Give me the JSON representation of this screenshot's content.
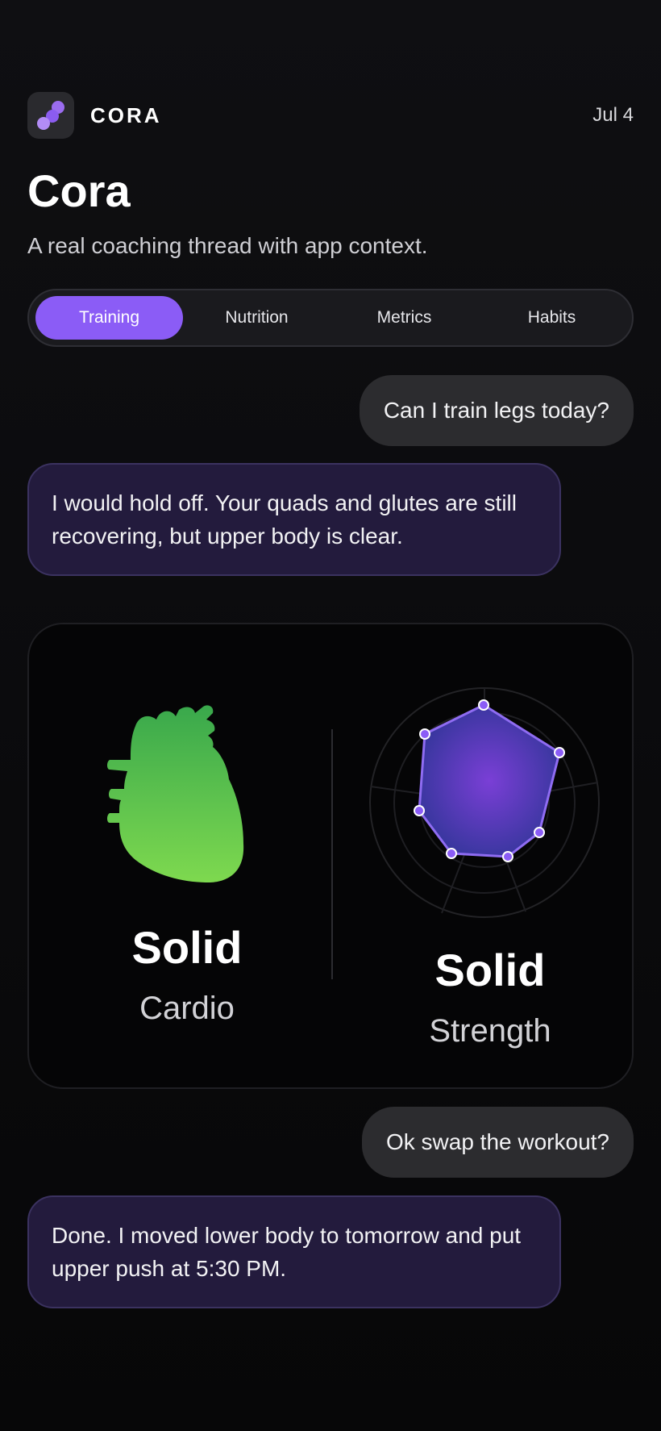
{
  "app": {
    "brand": "CORA",
    "date": "Jul 4",
    "title": "Cora",
    "subtitle": "A real coaching thread with app context."
  },
  "tabs": [
    {
      "label": "Training",
      "active": true
    },
    {
      "label": "Nutrition",
      "active": false
    },
    {
      "label": "Metrics",
      "active": false
    },
    {
      "label": "Habits",
      "active": false
    }
  ],
  "messages": [
    {
      "role": "user",
      "text": "Can I train legs today?"
    },
    {
      "role": "coach",
      "text": "I would hold off. Your quads and glutes are still recovering, but upper body is clear."
    },
    {
      "role": "user",
      "text": "Ok swap the workout?"
    },
    {
      "role": "coach",
      "text": "Done. I moved lower body to tomorrow and put upper push at 5:30 PM."
    }
  ],
  "card": {
    "cardio": {
      "status": "Solid",
      "label": "Cardio",
      "icon": "heart-icon"
    },
    "strength": {
      "status": "Solid",
      "label": "Strength",
      "icon": "radar-chart-icon"
    }
  },
  "colors": {
    "accent": "#8b5cf6",
    "heart_top": "#39a84c",
    "heart_bottom": "#7ed94f",
    "radar_fill": "#3b3a9c"
  }
}
